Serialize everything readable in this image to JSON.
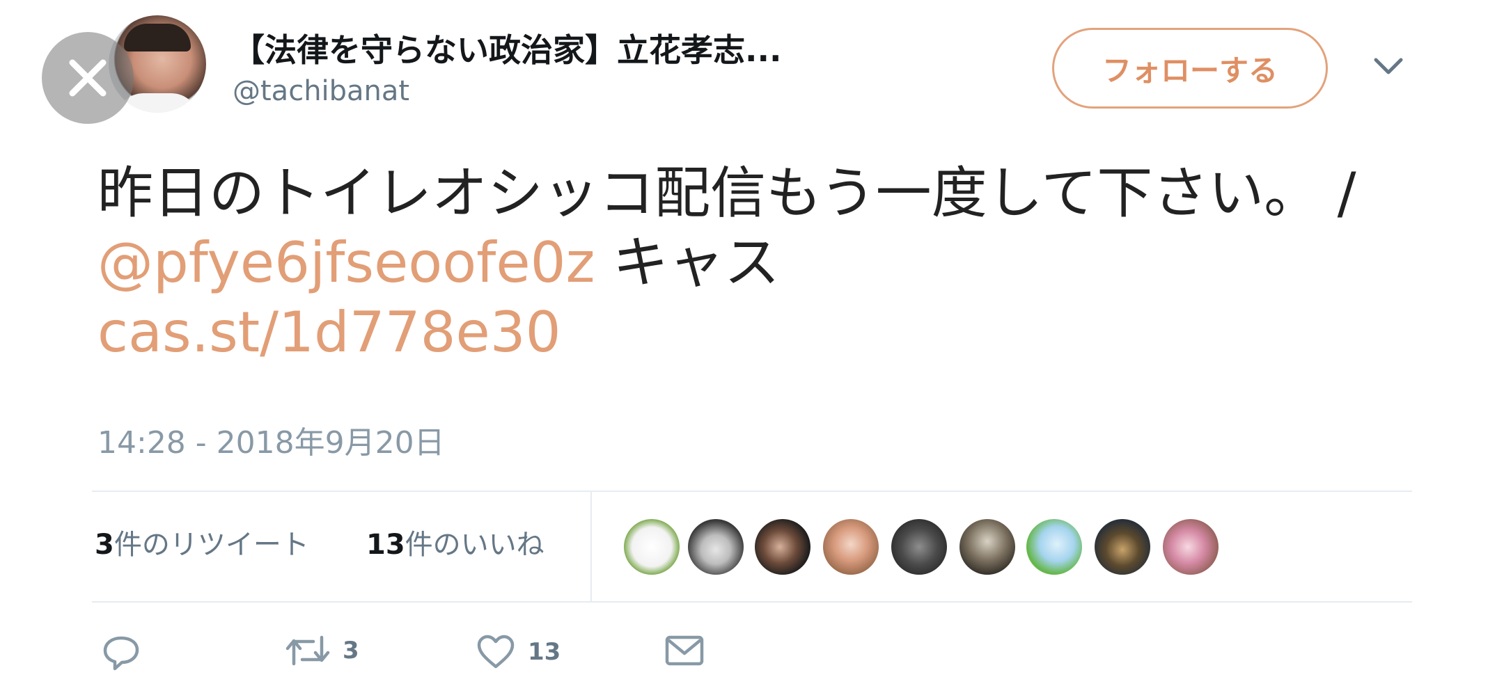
{
  "tweet": {
    "display_name": "【法律を守らない政治家】立花孝志...",
    "handle": "@tachibanat",
    "follow_label": "フォローする",
    "text_before": "昨日のトイレオシッコ配信もう一度して下さい。 / ",
    "mention": "@pfye6jfseoofe0z",
    "text_after": " キャス",
    "link": "cas.st/1d778e30",
    "timestamp": "14:28 - 2018年9月20日"
  },
  "stats": {
    "retweets_count": "3",
    "retweets_label": "件のリツイート",
    "likes_count": "13",
    "likes_label": "件のいいね"
  },
  "actions": {
    "retweet_count": "3",
    "like_count": "13"
  },
  "colors": {
    "accent": "#e29e76",
    "muted": "#657786",
    "divider": "#e6ecf0"
  },
  "icons": [
    "close-icon",
    "chevron-down-icon",
    "reply-icon",
    "retweet-icon",
    "heart-icon",
    "mail-icon"
  ]
}
